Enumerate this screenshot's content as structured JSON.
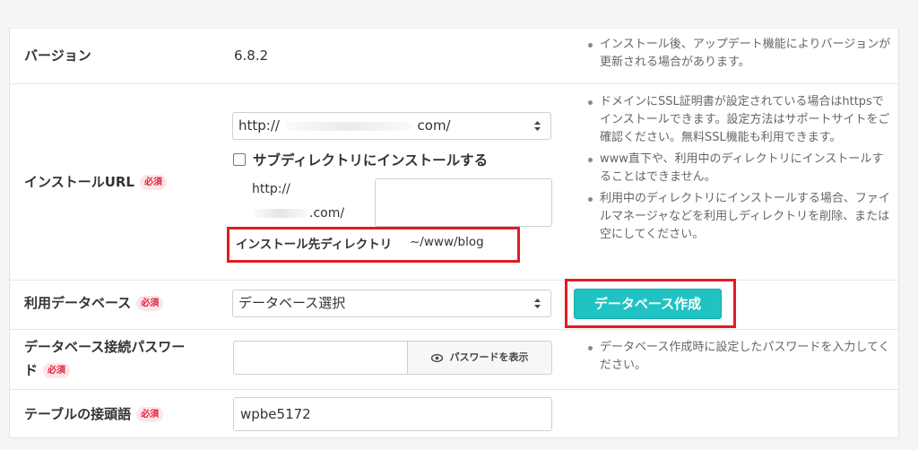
{
  "rows": {
    "version": {
      "label": "バージョン",
      "value": "6.8.2",
      "note": "インストール後、アップデート機能によりバージョンが更新される場合があります。"
    },
    "install_url": {
      "label": "インストールURL",
      "required": "必須",
      "select_value_prefix": "http://",
      "select_value_suffix": "com/",
      "subdir_checkbox": "サブディレクトリにインストールする",
      "subdir_prefix_line1": "http://",
      "subdir_prefix_line2": ".com/",
      "dir_label": "インストール先ディレクトリ",
      "dir_value": "~/www/blog",
      "notes": [
        "ドメインにSSL証明書が設定されている場合はhttpsでインストールできます。設定方法はサポートサイトをご確認ください。無料SSL機能も利用できます。",
        "www直下や、利用中のディレクトリにインストールすることはできません。",
        "利用中のディレクトリにインストールする場合、ファイルマネージャなどを利用しディレクトリを削除、または空にしてください。"
      ]
    },
    "database": {
      "label": "利用データベース",
      "required": "必須",
      "select_value": "データベース選択",
      "create_button": "データベース作成"
    },
    "db_password": {
      "label_line1": "データベース接続パスワー",
      "label_line2": "ド",
      "required": "必須",
      "show_button": "パスワードを表示",
      "note": "データベース作成時に設定したパスワードを入力してください。"
    },
    "table_prefix": {
      "label": "テーブルの接頭語",
      "required": "必須",
      "value": "wpbe5172"
    }
  },
  "colors": {
    "accent_button": "#1fc3c4",
    "highlight_box": "#e21b24",
    "required_badge_text": "#e0233e",
    "required_badge_bg": "#fde5e5"
  }
}
